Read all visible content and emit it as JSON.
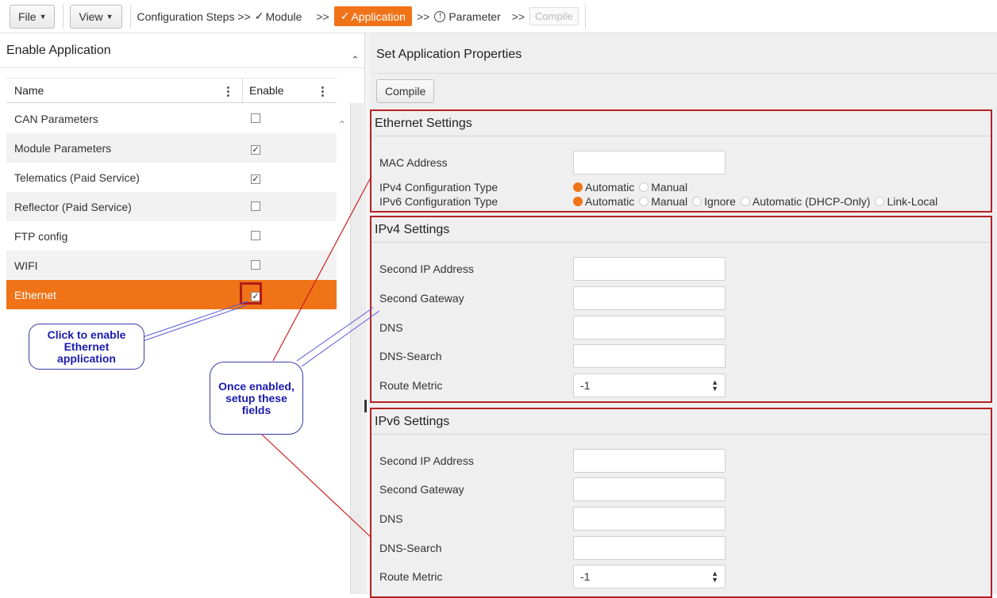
{
  "toolbar": {
    "file_label": "File",
    "view_label": "View",
    "steps_prefix": "Configuration Steps >>",
    "step_module": "Module",
    "sep": ">>",
    "step_application": "Application",
    "step_parameter": "Parameter",
    "step_compile": "Compile",
    "accent_color": "#f07317"
  },
  "left_panel": {
    "title": "Enable Application",
    "columns": [
      "Name",
      "Enable"
    ],
    "rows": [
      {
        "name": "CAN Parameters",
        "enabled": false
      },
      {
        "name": "Module Parameters",
        "enabled": true
      },
      {
        "name": "Telematics (Paid Service)",
        "enabled": true
      },
      {
        "name": "Reflector (Paid Service)",
        "enabled": false
      },
      {
        "name": "FTP config",
        "enabled": false
      },
      {
        "name": "WIFI",
        "enabled": false
      },
      {
        "name": "Ethernet",
        "enabled": true,
        "selected": true
      }
    ]
  },
  "right_panel": {
    "title": "Set Application Properties",
    "compile_label": "Compile",
    "ethernet": {
      "title": "Ethernet Settings",
      "mac_label": "MAC Address",
      "mac_value": "",
      "ipv4_label": "IPv4 Configuration Type",
      "ipv4_options": [
        "Automatic",
        "Manual"
      ],
      "ipv4_selected": "Automatic",
      "ipv6_label": "IPv6 Configuration Type",
      "ipv6_options": [
        "Automatic",
        "Manual",
        "Ignore",
        "Automatic (DHCP-Only)",
        "Link-Local"
      ],
      "ipv6_selected": "Automatic"
    },
    "ipv4": {
      "title": "IPv4 Settings",
      "fields": [
        "Second IP Address",
        "Second Gateway",
        "DNS",
        "DNS-Search"
      ],
      "route_metric_label": "Route Metric",
      "route_metric_value": "-1"
    },
    "ipv6": {
      "title": "IPv6 Settings",
      "fields": [
        "Second IP Address",
        "Second Gateway",
        "DNS",
        "DNS-Search"
      ],
      "route_metric_label": "Route Metric",
      "route_metric_value": "-1"
    }
  },
  "annotations": {
    "callout1": [
      "Click to enable",
      "Ethernet",
      "application"
    ],
    "callout2": [
      "Once enabled,",
      "setup these",
      "fields"
    ],
    "highlight_color": "#b52222",
    "callout_color": "#1a1ab0"
  }
}
